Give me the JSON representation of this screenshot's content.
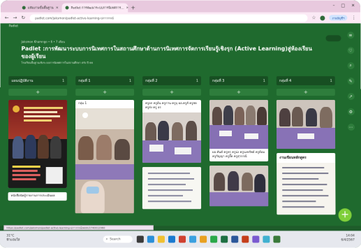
{
  "browser": {
    "tabs": [
      {
        "label": "แฟ้มงานขั้นพื้นฐาน",
        "active": false
      },
      {
        "label": "Padlet การพัฒนาระบบการนิเทศการ...",
        "active": true
      }
    ],
    "new_tab": "+",
    "window_controls": [
      "–",
      "□",
      "✕"
    ],
    "url": "padlet.com/jaksmon/padlet-active-learning-ปภาวรรณ์",
    "profile_pill": "งานบัญชีฯ"
  },
  "padlet": {
    "brand": "Padlet",
    "author_meta": "Jaksmon Khamngo • 6 • 7 เดือน",
    "title": "Padlet :การพัฒนาระบบการนิเทศการในสถานศึกษาด้านการนิเทศการจัดการเรียนรู้เชิงรุก (Active Learning)สู่ห้องเรียน ของผู้เรียน",
    "subtitle": "โรงเรียนพื้นฐานเชิงระบบการนิเทศการในสถานศึกษา ตรัง ปี 66",
    "sidebar_icons": [
      "menu-icon",
      "heart-icon",
      "search-icon",
      "comment-icon",
      "share-icon",
      "gear-icon",
      "more-icon"
    ],
    "columns": [
      {
        "title": "แผนปฏิบัติงาน",
        "count": "1",
        "card_text": "หนังสือนัดผู้รายงานการประเมินผล"
      },
      {
        "title": "กลุ่มที่ 1",
        "count": "1",
        "card_text": "กลุ่ม 1"
      },
      {
        "title": "กลุ่มที่ 2",
        "count": "1",
        "card_text": "ครูอก ครูอ้น ครูกาน ครูบุ ผอ.ครูส์ ครูสด ครูส่ง ครู อร"
      },
      {
        "title": "กลุ่มที่ 3",
        "count": "1",
        "card_text": "ผอ.ทันต์ ครูทร ครูน่ง ครูนงทรัพย์ ครูต้อม ครูกัญญา ครูอี๊ด ครูสุวรรณี"
      },
      {
        "title": "กลุ่มที่ 4",
        "count": "1",
        "card_text": "งานเขียนหลักสูตร"
      }
    ],
    "add_label": "+",
    "fab": "+"
  },
  "status_url": "https://padlet.com/jaksmon/padlet-active-learning-ปภาวรรณ์/wish/2740012960",
  "taskbar": {
    "weather_temp": "31°C",
    "weather_desc": "ฟ้าแจ่มใส",
    "search_label": "Search",
    "time": "14:04",
    "date": "6/4/2567"
  }
}
